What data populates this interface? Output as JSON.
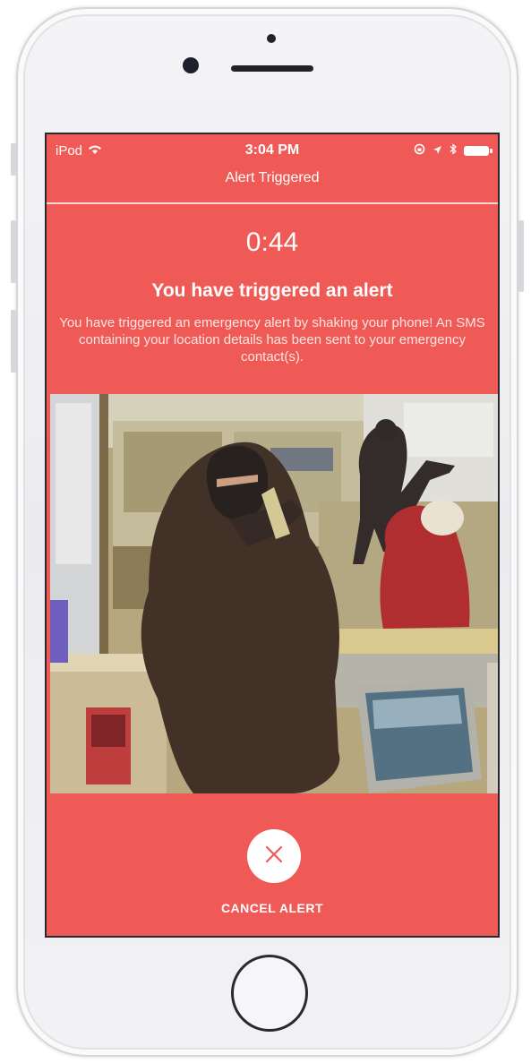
{
  "status_bar": {
    "carrier": "iPod",
    "time": "3:04 PM",
    "icons": [
      "wifi-icon",
      "screen-rotation-lock-icon",
      "location-arrow-icon",
      "bluetooth-icon",
      "battery-icon"
    ]
  },
  "nav": {
    "title": "Alert Triggered"
  },
  "alert": {
    "timer": "0:44",
    "heading": "You have triggered an alert",
    "message": "You have triggered an emergency alert by shaking your phone! An SMS containing your location details has been sent to your emergency contact(s)."
  },
  "photo": {
    "icon": "security-camera-photo"
  },
  "cancel": {
    "label": "CANCEL ALERT",
    "icon": "close-icon"
  },
  "colors": {
    "screen_background": "#f05a56",
    "text": "#ffffff",
    "button_background": "#ffffff",
    "button_icon": "#f05a56"
  }
}
